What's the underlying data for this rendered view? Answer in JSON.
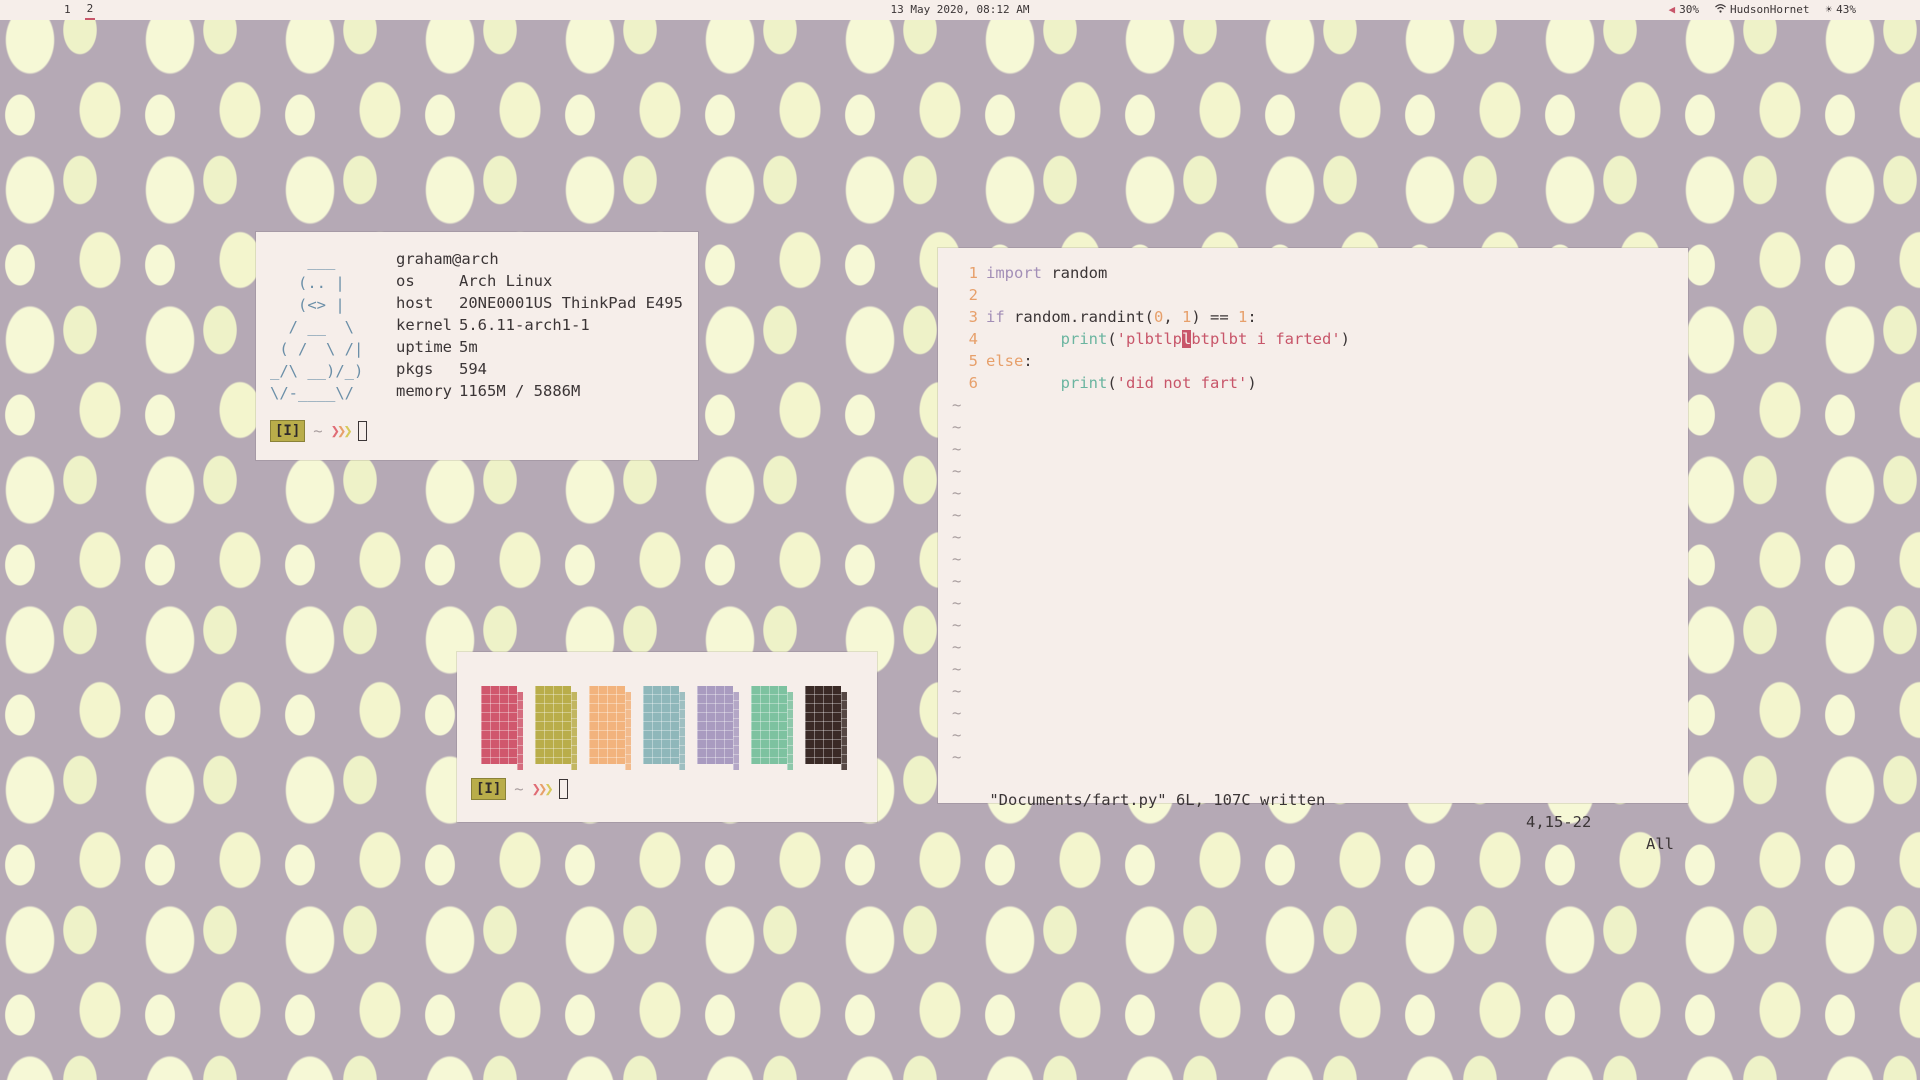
{
  "topbar": {
    "workspaces": [
      "1",
      "2"
    ],
    "active_workspace": "2",
    "datetime": "13 May 2020, 08:12 AM",
    "volume": "30%",
    "wifi": "HudsonHornet",
    "brightness": "43%"
  },
  "neofetch": {
    "ascii": "    ___\n   (.. |\n   (<> |\n  / __  \\\n ( /  \\ /|\n_/\\ __)/_)\n\\/-____\\/",
    "user_host": "graham@arch",
    "rows": [
      {
        "key": "os",
        "value": "Arch Linux"
      },
      {
        "key": "host",
        "value": "20NE0001US ThinkPad E495"
      },
      {
        "key": "kernel",
        "value": "5.6.11-arch1-1"
      },
      {
        "key": "uptime",
        "value": "5m"
      },
      {
        "key": "pkgs",
        "value": "594"
      },
      {
        "key": "memory",
        "value": "1165M / 5886M"
      }
    ],
    "prompt": {
      "mode": "[I]",
      "dir": "~",
      "chevrons": "❯❯❯"
    }
  },
  "colorscheme": {
    "swatches": [
      "#d0576d",
      "#b9ad4a",
      "#f2b37d",
      "#8fb7ba",
      "#a99bc0",
      "#7dc2a0",
      "#3a2a26"
    ],
    "prompt": {
      "mode": "[I]",
      "dir": "~",
      "chevrons": "❯❯❯"
    }
  },
  "vim": {
    "lines": [
      {
        "n": "1",
        "segs": [
          {
            "t": "import",
            "c": "kw"
          },
          {
            "t": " random",
            "c": ""
          }
        ]
      },
      {
        "n": "2",
        "segs": []
      },
      {
        "n": "3",
        "segs": [
          {
            "t": "if",
            "c": "kw"
          },
          {
            "t": " random.randint(",
            "c": ""
          },
          {
            "t": "0",
            "c": "num"
          },
          {
            "t": ", ",
            "c": ""
          },
          {
            "t": "1",
            "c": "num"
          },
          {
            "t": ") == ",
            "c": ""
          },
          {
            "t": "1",
            "c": "num"
          },
          {
            "t": ":",
            "c": ""
          }
        ]
      },
      {
        "n": "4",
        "segs": [
          {
            "t": "        ",
            "c": ""
          },
          {
            "t": "print",
            "c": "fn"
          },
          {
            "t": "(",
            "c": ""
          },
          {
            "t": "'plbtlp",
            "c": "str"
          },
          {
            "t": "l",
            "c": "cur"
          },
          {
            "t": "btplbt i farted'",
            "c": "str"
          },
          {
            "t": ")",
            "c": ""
          }
        ]
      },
      {
        "n": "5",
        "segs": [
          {
            "t": "else",
            "c": "kw2"
          },
          {
            "t": ":",
            "c": ""
          }
        ]
      },
      {
        "n": "6",
        "segs": [
          {
            "t": "        ",
            "c": ""
          },
          {
            "t": "print",
            "c": "fn"
          },
          {
            "t": "(",
            "c": ""
          },
          {
            "t": "'did not fart'",
            "c": "str"
          },
          {
            "t": ")",
            "c": ""
          }
        ]
      }
    ],
    "empty_marker": "~",
    "empty_count": 17,
    "status_message": "\"Documents/fart.py\" 6L, 107C written",
    "cursor_pos": "4,15-22",
    "scroll": "All"
  }
}
